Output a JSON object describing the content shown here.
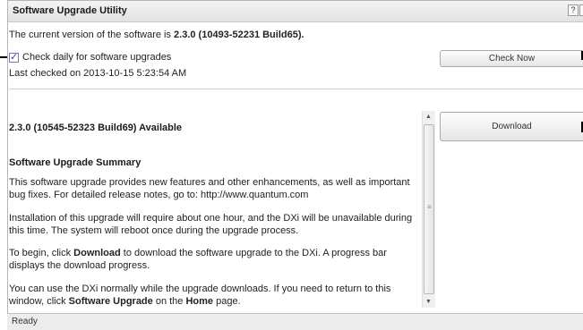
{
  "window": {
    "title": "Software Upgrade Utility",
    "help_label": "?",
    "close_label": "x"
  },
  "current": {
    "prefix": "The current version of the software is ",
    "version": "2.3.0 (10493-52231 Build65)."
  },
  "auto_check": {
    "label": "Check daily for software upgrades",
    "checked": true
  },
  "last_checked": "Last checked on 2013-10-15 5:23:54 AM",
  "buttons": {
    "check_now": "Check Now",
    "download": "Download"
  },
  "available": {
    "title": "2.3.0 (10545-52323 Build69) Available",
    "summary_title": "Software Upgrade Summary",
    "paragraphs": {
      "p1": "This software upgrade provides new features and other enhancements, as well as important bug fixes. For detailed release notes, go to: http://www.quantum.com",
      "p2": "Installation of this upgrade will require about one hour, and the DXi will be unavailable during this time. The system will reboot once during the upgrade process.",
      "p3_a": "To begin, click ",
      "p3_b": "Download",
      "p3_c": " to download the software upgrade to the DXi. A progress bar displays the download progress.",
      "p4_a": "You can use the DXi normally while the upgrade downloads. If you need to return to this window, click ",
      "p4_b": "Software Upgrade",
      "p4_c": " on the ",
      "p4_d": "Home",
      "p4_e": " page."
    }
  },
  "status": "Ready",
  "icons": {
    "help": "help-icon",
    "close": "close-icon",
    "check": "checkmark-icon",
    "scroll_up": "scroll-up-arrow-icon",
    "scroll_down": "scroll-down-arrow-icon"
  }
}
